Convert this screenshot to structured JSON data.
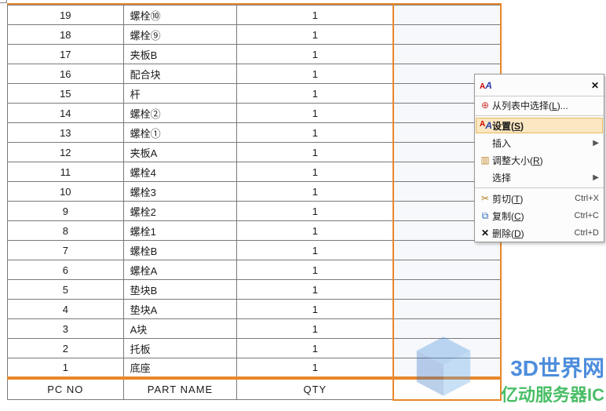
{
  "table": {
    "rows": [
      {
        "idx": "19",
        "name": "螺栓⑩",
        "qty": "1"
      },
      {
        "idx": "18",
        "name": "螺栓⑨",
        "qty": "1"
      },
      {
        "idx": "17",
        "name": "夹板B",
        "qty": "1"
      },
      {
        "idx": "16",
        "name": "配合块",
        "qty": "1"
      },
      {
        "idx": "15",
        "name": "杆",
        "qty": "1"
      },
      {
        "idx": "14",
        "name": "螺栓②",
        "qty": "1"
      },
      {
        "idx": "13",
        "name": "螺栓①",
        "qty": "1"
      },
      {
        "idx": "12",
        "name": "夹板A",
        "qty": "1"
      },
      {
        "idx": "11",
        "name": "螺栓4",
        "qty": "1"
      },
      {
        "idx": "10",
        "name": "螺栓3",
        "qty": "1"
      },
      {
        "idx": "9",
        "name": "螺栓2",
        "qty": "1"
      },
      {
        "idx": "8",
        "name": "螺栓1",
        "qty": "1"
      },
      {
        "idx": "7",
        "name": "螺栓B",
        "qty": "1"
      },
      {
        "idx": "6",
        "name": "螺栓A",
        "qty": "1"
      },
      {
        "idx": "5",
        "name": "垫块B",
        "qty": "1"
      },
      {
        "idx": "4",
        "name": "垫块A",
        "qty": "1"
      },
      {
        "idx": "3",
        "name": "A块",
        "qty": "1"
      },
      {
        "idx": "2",
        "name": "托板",
        "qty": "1"
      },
      {
        "idx": "1",
        "name": "底座",
        "qty": "1"
      }
    ],
    "footer": {
      "pc": "PC NO",
      "part": "PART NAME",
      "qty": "QTY"
    }
  },
  "ctx": {
    "pick": "从列表中选择(L)...",
    "settings": "设置(S)",
    "insert": "插入",
    "resize": "调整大小(R)",
    "select": "选择",
    "cut": "剪切(T)",
    "cut_sc": "Ctrl+X",
    "copy": "复制(C)",
    "copy_sc": "Ctrl+C",
    "del": "删除(D)",
    "del_sc": "Ctrl+D"
  },
  "wm": {
    "line1": "3D世界网",
    "line2": "亿动服务器IC"
  }
}
